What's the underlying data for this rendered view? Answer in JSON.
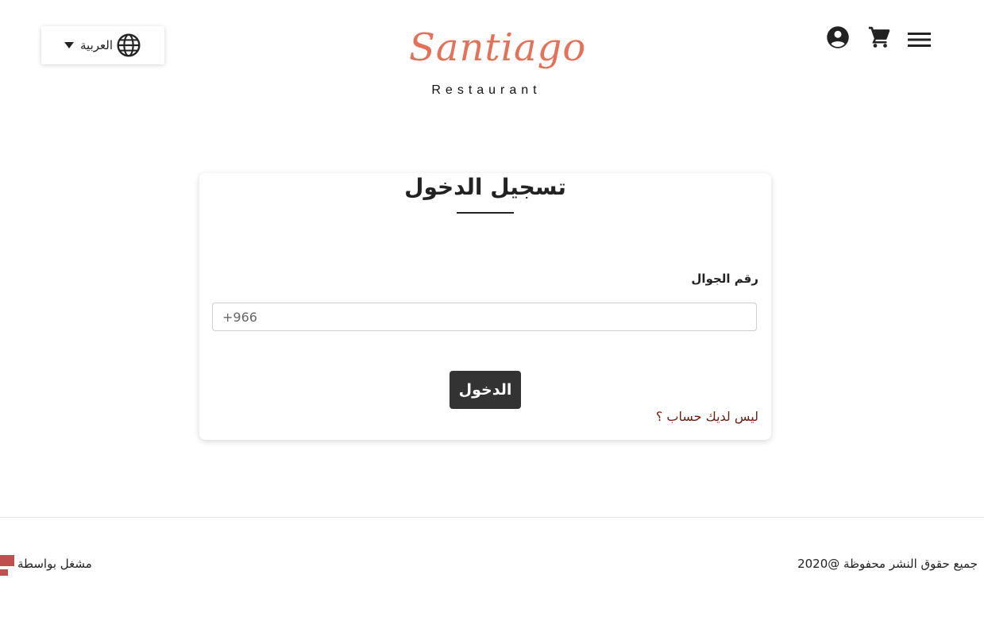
{
  "header": {
    "language_label": "العربية",
    "logo_script": "Santiago",
    "logo_subtitle": "Restaurant"
  },
  "login": {
    "title": "تسجيل الدخول",
    "phone_label": "رقم الجوال",
    "phone_placeholder": "+966",
    "submit_label": "الدخول",
    "register_link": "ليس لديك حساب ؟"
  },
  "footer": {
    "copyright": "جميع حقوق النشر محفوظة @2020",
    "powered_by": "مشغل بواسطة"
  },
  "icons": {
    "language": "globe-icon",
    "dropdown": "caret-down-icon",
    "account": "account-circle-icon",
    "cart": "shopping-cart-icon",
    "menu": "hamburger-menu-icon"
  },
  "colors": {
    "brand": "#e2735a",
    "button_bg": "#333333",
    "link": "#6b1f10",
    "powered_logo": "#c0504d"
  }
}
